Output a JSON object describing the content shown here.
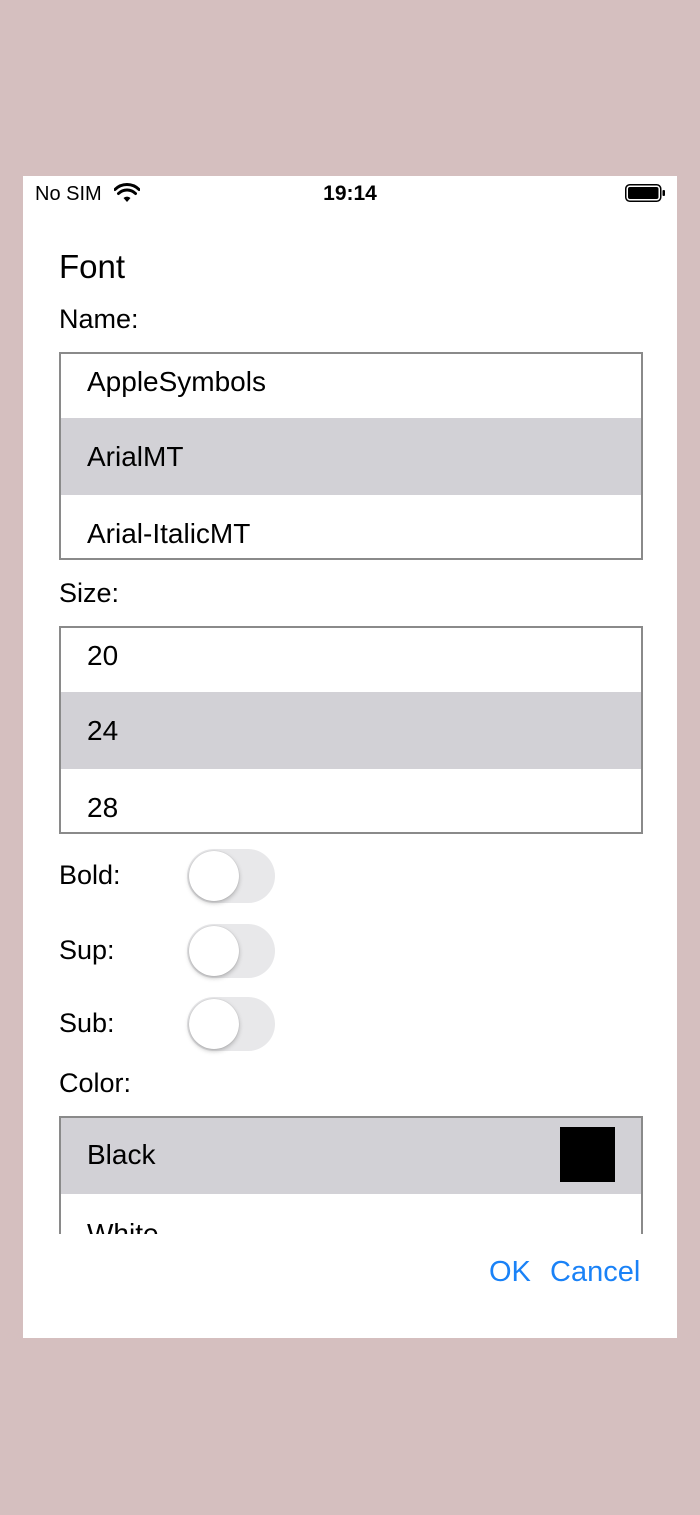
{
  "status_bar": {
    "carrier": "No SIM",
    "time": "19:14"
  },
  "dialog": {
    "title": "Font",
    "name_label": "Name:",
    "name_options": [
      "AppleSymbols",
      "ArialMT",
      "Arial-ItalicMT"
    ],
    "name_selected": "ArialMT",
    "size_label": "Size:",
    "size_options": [
      "20",
      "24",
      "28"
    ],
    "size_selected": "24",
    "bold_label": "Bold:",
    "bold_on": false,
    "sup_label": "Sup:",
    "sup_on": false,
    "sub_label": "Sub:",
    "sub_on": false,
    "color_label": "Color:",
    "color_options": [
      "Black",
      "White"
    ],
    "color_selected": "Black",
    "swatch_color": "#000000",
    "ok_label": "OK",
    "cancel_label": "Cancel"
  },
  "accent_color": "#1a82f7",
  "background_color": "#d5bfbf",
  "selected_row_color": "#d2d1d6"
}
